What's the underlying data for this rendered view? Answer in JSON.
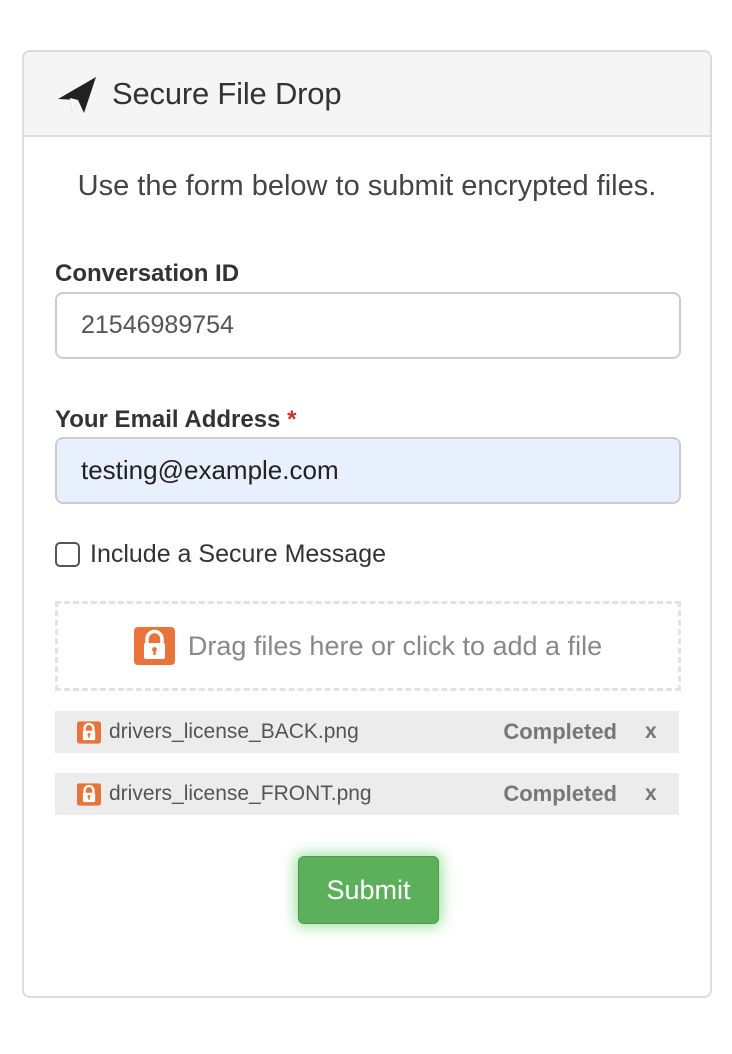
{
  "header": {
    "title": "Secure File Drop",
    "icon": "paper-plane-icon"
  },
  "intro_text": "Use the form below to submit encrypted files.",
  "conversation": {
    "label": "Conversation ID",
    "value": "21546989754"
  },
  "email": {
    "label": "Your Email Address",
    "required_mark": "*",
    "value": "testing@example.com"
  },
  "secure_message": {
    "label": "Include a Secure Message",
    "checked": false
  },
  "dropzone": {
    "text": "Drag files here or click to add a file",
    "icon": "lock-icon"
  },
  "files": [
    {
      "name": "drivers_license_BACK.png",
      "status": "Completed",
      "remove": "x"
    },
    {
      "name": "drivers_license_FRONT.png",
      "status": "Completed",
      "remove": "x"
    }
  ],
  "submit_label": "Submit",
  "colors": {
    "accent_orange": "#e8743b",
    "submit_green": "#5cb05c",
    "autofill_blue": "#e8f0fe",
    "required_red": "#c9302c"
  }
}
